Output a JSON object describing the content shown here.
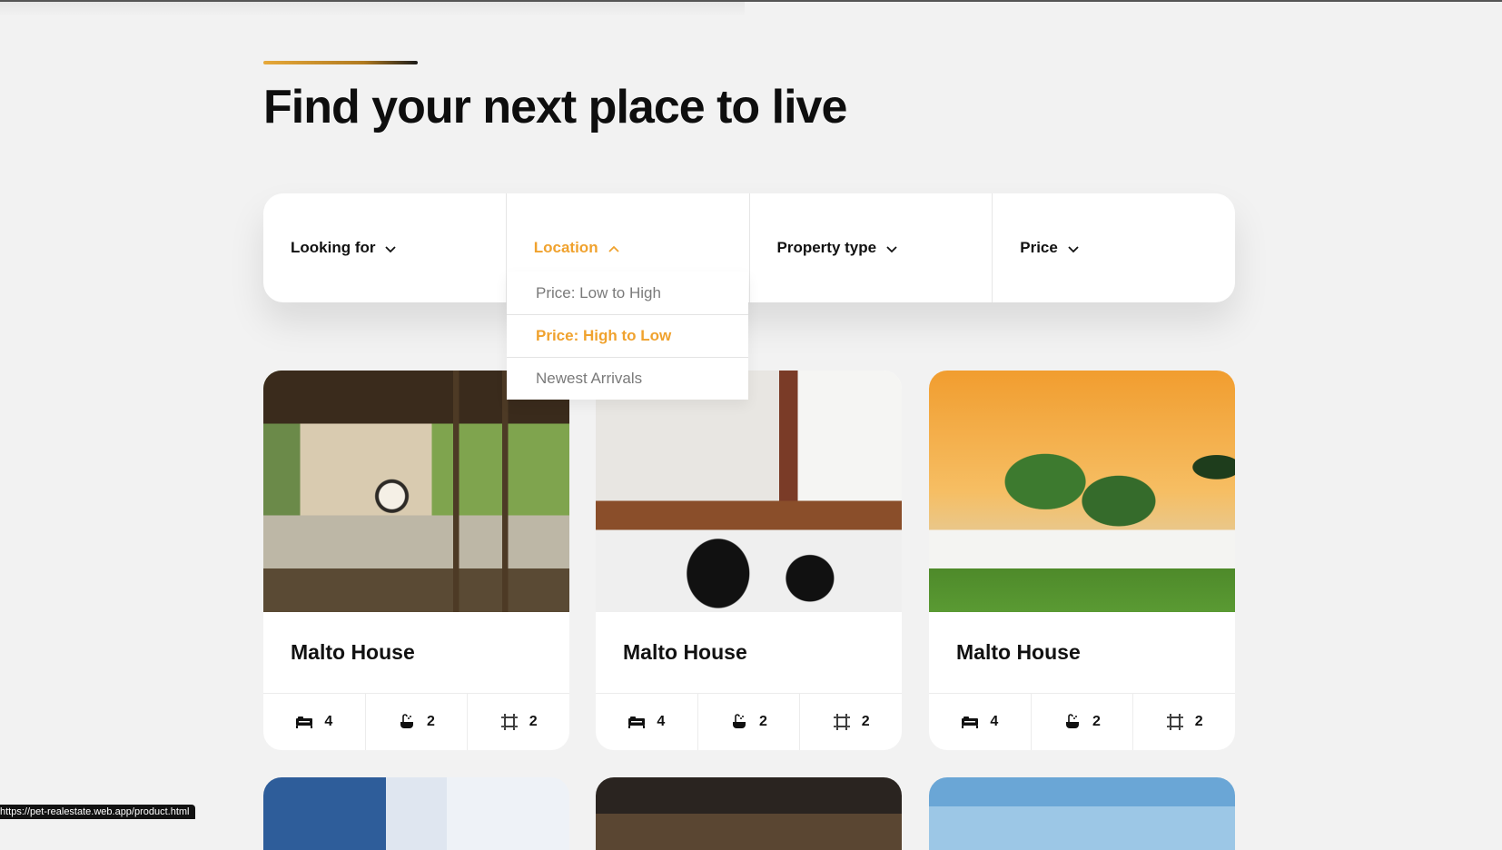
{
  "page": {
    "heading": "Find your next place to live"
  },
  "filters": [
    {
      "label": "Looking for",
      "open": false
    },
    {
      "label": "Location",
      "open": true
    },
    {
      "label": "Property type",
      "open": false
    },
    {
      "label": "Price",
      "open": false
    }
  ],
  "dropdown": {
    "options": [
      "Price: Low to High",
      "Price: High to Low",
      "Newest Arrivals"
    ],
    "selected": "Price: High to Low"
  },
  "listings": [
    {
      "title": "Malto House",
      "beds": "4",
      "baths": "2",
      "area": "2"
    },
    {
      "title": "Malto House",
      "beds": "4",
      "baths": "2",
      "area": "2"
    },
    {
      "title": "Malto House",
      "beds": "4",
      "baths": "2",
      "area": "2"
    }
  ],
  "status_bar": {
    "url": "https://pet-realestate.web.app/product.html"
  },
  "colors": {
    "accent": "#f0a22e",
    "background": "#f2f2f2",
    "card": "#ffffff"
  },
  "icons": {
    "beds": "bed-icon",
    "baths": "bath-icon",
    "area": "area-icon",
    "chevron": "chevron-down-icon"
  }
}
